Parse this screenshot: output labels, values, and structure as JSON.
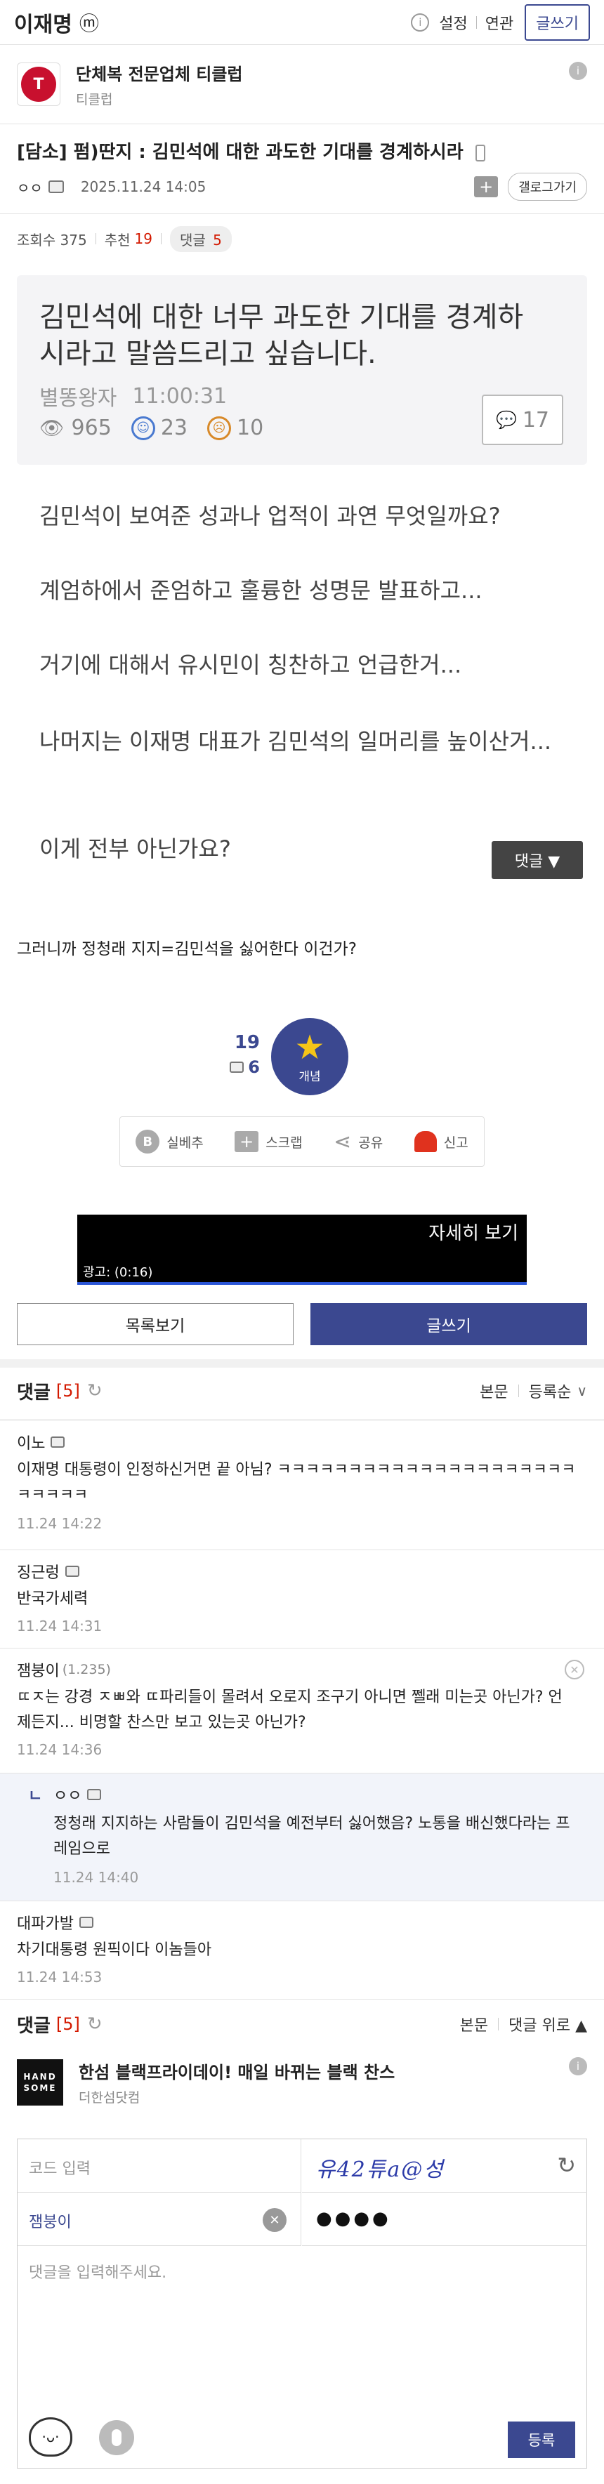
{
  "header": {
    "gallery_name": "이재명",
    "gallery_badge": "ⓜ",
    "settings_label": "설정",
    "related_label": "연관",
    "write_label": "글쓰기"
  },
  "ad_top": {
    "title": "단체복 전문업체 티클럽",
    "subtitle": "티클럽",
    "logo_text": "T"
  },
  "post": {
    "title": "[담소] 펌)딴지 : 김민석에 대한 과도한 기대를 경계하시라",
    "author": "ㅇㅇ",
    "datetime": "2025.11.24 14:05",
    "gallery_go_label": "갤로그가기",
    "views_label": "조회수 375",
    "recommend_label": "추천",
    "recommend_count": "19",
    "comment_label": "댓글",
    "comment_count": "5"
  },
  "embed": {
    "title": "김민석에 대한 너무 과도한 기대를 경계하시라고 말씀드리고 싶습니다.",
    "author": "별똥왕자",
    "time": "11:00:31",
    "views": "965",
    "likes": "23",
    "dislikes": "10",
    "comments": "17",
    "lines": [
      "김민석이 보여준 성과나 업적이 과연 무엇일까요?",
      "계엄하에서 준엄하고 훌륭한 성명문 발표하고...",
      "거기에 대해서 유시민이 칭찬하고 언급한거...",
      "나머지는 이재명 대표가 김민석의 일머리를 높이산거...",
      "이게 전부 아닌가요?"
    ],
    "comment_button": "댓글 ▼"
  },
  "body_text": "그러니까 정청래 지지=김민석을 싫어한다 이건가?",
  "vote": {
    "up_count": "19",
    "fix_count": "6",
    "concept_label": "개념"
  },
  "actions": {
    "silbest": "실베추",
    "scrap": "스크랩",
    "share": "공유",
    "report": "신고"
  },
  "video_ad": {
    "detail_label": "자세히 보기",
    "ad_label": "광고: (0:16)"
  },
  "nav": {
    "list_label": "목록보기",
    "write_label": "글쓰기"
  },
  "comments_header": {
    "label": "댓글",
    "count": "[5]",
    "body_label": "본문",
    "order_label": "등록순"
  },
  "comments": [
    {
      "name": "이노",
      "text": "이재명 대통령이 인정하신거면 끝 아님? ㅋㅋㅋㅋㅋㅋㅋㅋㅋㅋㅋㅋㅋㅋㅋㅋㅋㅋㅋㅋㅋㅋㅋㅋㅋㅋ",
      "time": "11.24 14:22"
    },
    {
      "name": "징근렁",
      "text": "반국가세력",
      "time": "11.24 14:31"
    },
    {
      "name": "잼붕이",
      "ip": "(1.235)",
      "text": "ㄸㅈ는 강경 ㅈㅃ와 ㄸ파리들이 몰려서 오로지 조구기 아니면 쩰래 미는곳 아닌가? 언제든지... 비명할 찬스만 보고 있는곳 아닌가?",
      "time": "11.24 14:36"
    },
    {
      "name": "ㅇㅇ",
      "text": "정청래 지지하는 사람들이 김민석을 예전부터 싫어했음? 노통을 배신했다라는 프레임으로",
      "time": "11.24 14:40"
    },
    {
      "name": "대파가발",
      "text": "차기대통령 원픽이다 이놈들아",
      "time": "11.24 14:53"
    }
  ],
  "comments_footer": {
    "label": "댓글",
    "count": "[5]",
    "body_label": "본문",
    "top_label": "댓글 위로 ▲"
  },
  "ad_bottom": {
    "title": "한섬 블랙프라이데이! 매일 바뀌는 블랙 찬스",
    "subtitle": "더한섬닷컴",
    "logo_text": "HAND SOME"
  },
  "form": {
    "code_placeholder": "코드 입력",
    "captcha_text": "유42튜a@성",
    "nickname": "잼붕이",
    "password_mask": "●●●●",
    "comment_placeholder": "댓글을 입력해주세요.",
    "submit_label": "등록"
  },
  "colors": {
    "accent": "#3b4890",
    "red": "#d31900",
    "star": "#f5c518"
  }
}
